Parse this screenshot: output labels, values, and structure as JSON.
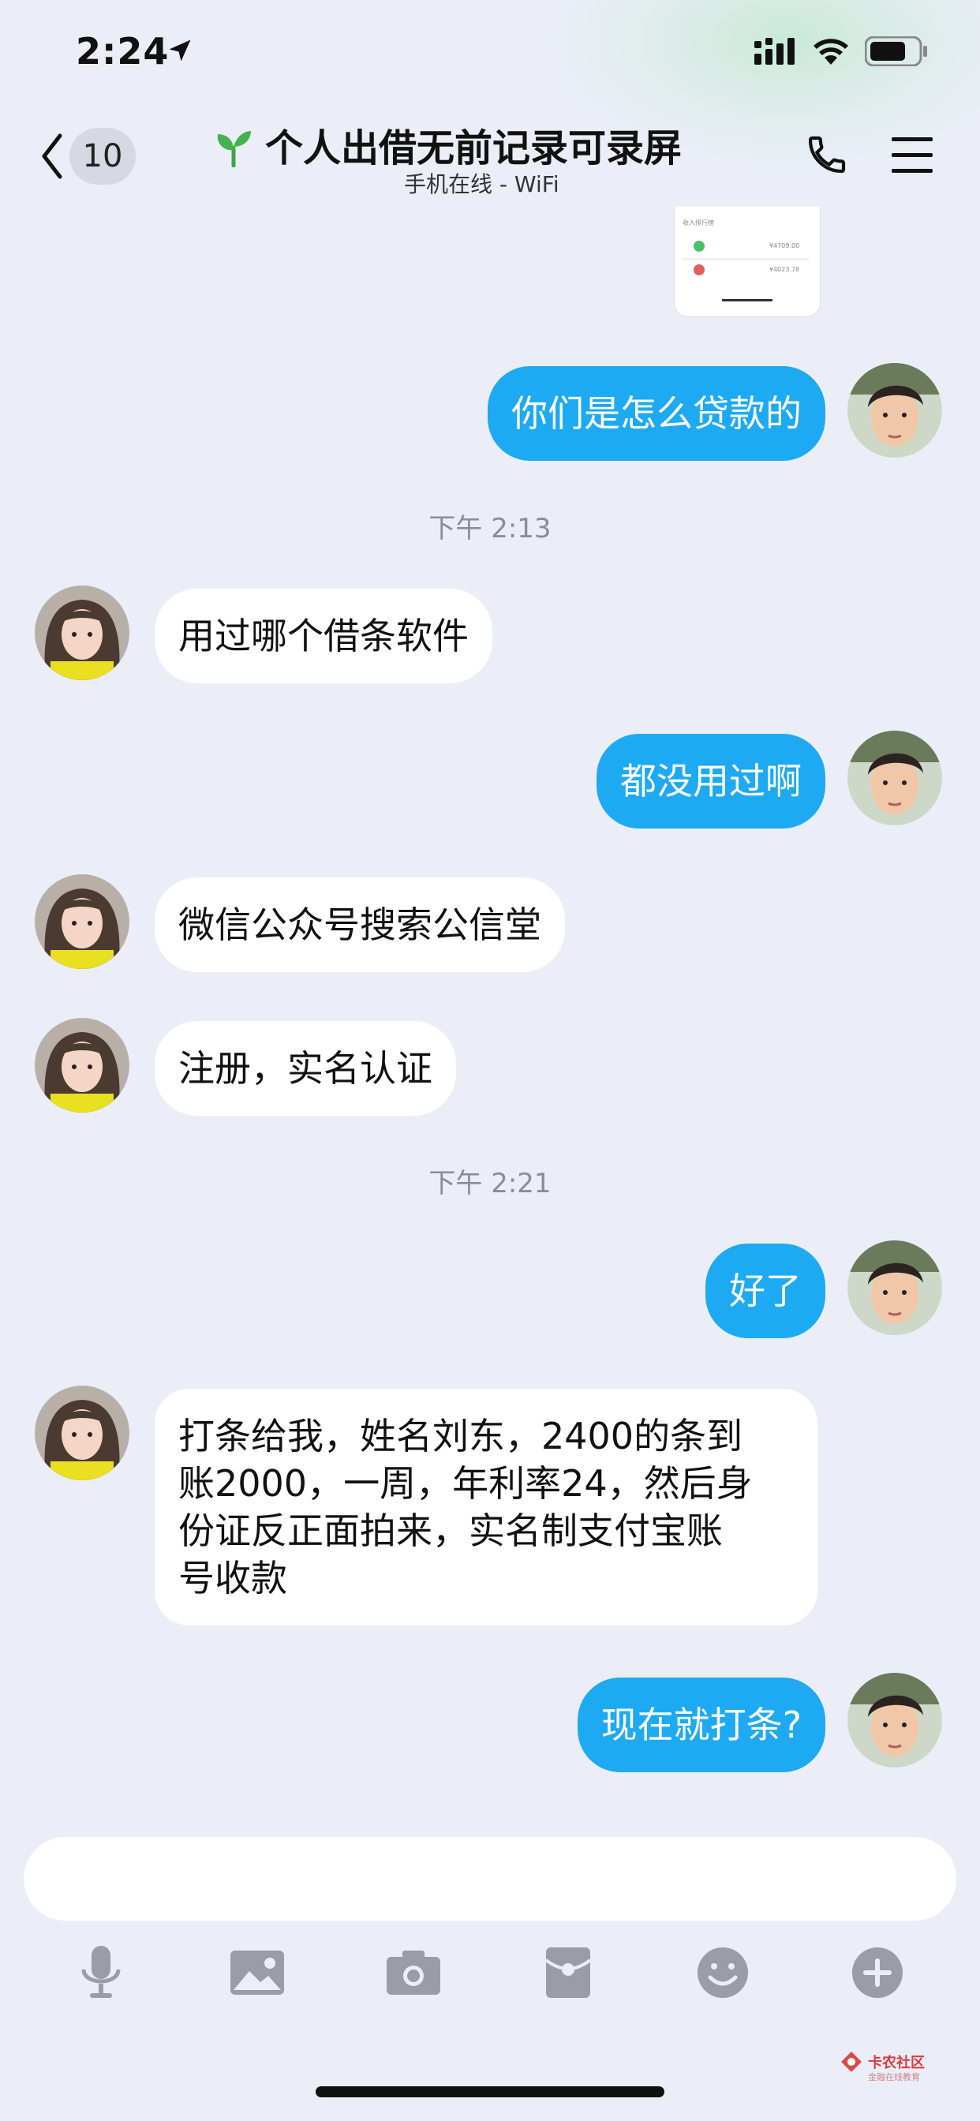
{
  "status_bar": {
    "time": "2:24"
  },
  "header": {
    "back_badge": "10",
    "title": "个人出借无前记录可录屏",
    "subtitle": "手机在线 - WiFi"
  },
  "thumbnail": {
    "label": "收入排行榜",
    "row1_amount": "¥4709.00",
    "row2_amount": "¥4023.78"
  },
  "messages": [
    {
      "side": "out",
      "text": "你们是怎么贷款的"
    },
    {
      "type": "time",
      "text": "下午 2:13"
    },
    {
      "side": "in",
      "text": "用过哪个借条软件"
    },
    {
      "side": "out",
      "text": "都没用过啊"
    },
    {
      "side": "in",
      "text": "微信公众号搜索公信堂"
    },
    {
      "side": "in",
      "text": "注册，实名认证"
    },
    {
      "type": "time",
      "text": "下午 2:21"
    },
    {
      "side": "out",
      "text": "好了"
    },
    {
      "side": "in",
      "lines": [
        "打条给我，姓名刘东，2400的条到",
        "账2000，一周，年利率24，然后身",
        "份证反正面拍来，实名制支付宝账",
        "号收款"
      ]
    },
    {
      "side": "out",
      "text": "现在就打条?"
    }
  ],
  "toolbar_icons": [
    "microphone-icon",
    "image-icon",
    "camera-icon",
    "red-packet-icon",
    "emoji-icon",
    "plus-icon"
  ],
  "watermark": {
    "text": "卡农社区",
    "sub": "金融在线教育"
  },
  "colors": {
    "outgoing_bubble": "#1daaf2",
    "incoming_bubble": "#ffffff",
    "background": "#eceef7"
  }
}
